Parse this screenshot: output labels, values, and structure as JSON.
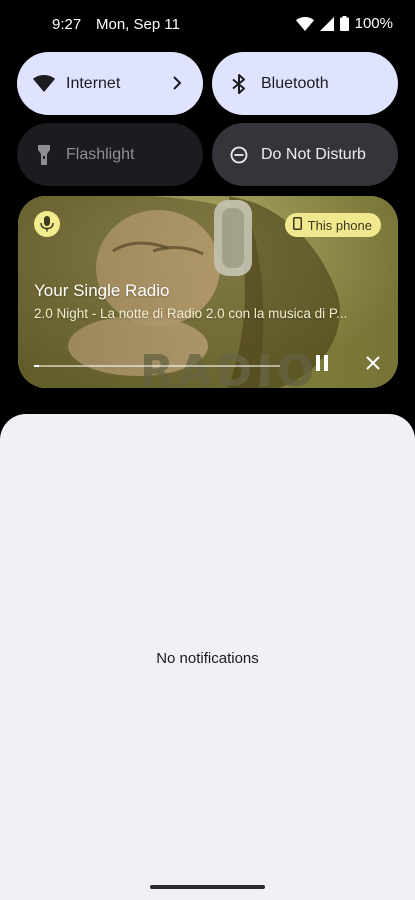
{
  "status_bar": {
    "time": "9:27",
    "date": "Mon, Sep 11",
    "battery_percent": "100%",
    "icons": [
      "wifi-icon",
      "cellular-signal-icon",
      "battery-icon"
    ]
  },
  "quick_settings": {
    "tiles": [
      {
        "label": "Internet",
        "icon": "wifi-icon",
        "state": "on",
        "has_chevron": true
      },
      {
        "label": "Bluetooth",
        "icon": "bluetooth-icon",
        "state": "on"
      },
      {
        "label": "Flashlight",
        "icon": "flashlight-icon",
        "state": "off"
      },
      {
        "label": "Do Not Disturb",
        "icon": "do-not-disturb-icon",
        "state": "off"
      }
    ]
  },
  "media": {
    "app_icon": "microphone-icon",
    "output_device": "This phone",
    "title": "Your Single Radio",
    "subtitle": "2.0 Night - La notte di Radio 2.0 con la musica di P...",
    "progress": 0.02,
    "controls": [
      "pause-icon",
      "close-icon"
    ],
    "accent_color": "#efe88e"
  },
  "notifications": {
    "empty_text": "No notifications"
  },
  "colors": {
    "tile_on": "#dfe3ff",
    "tile_off": "#1b1b20",
    "shade_background": "#f1f0f6"
  }
}
